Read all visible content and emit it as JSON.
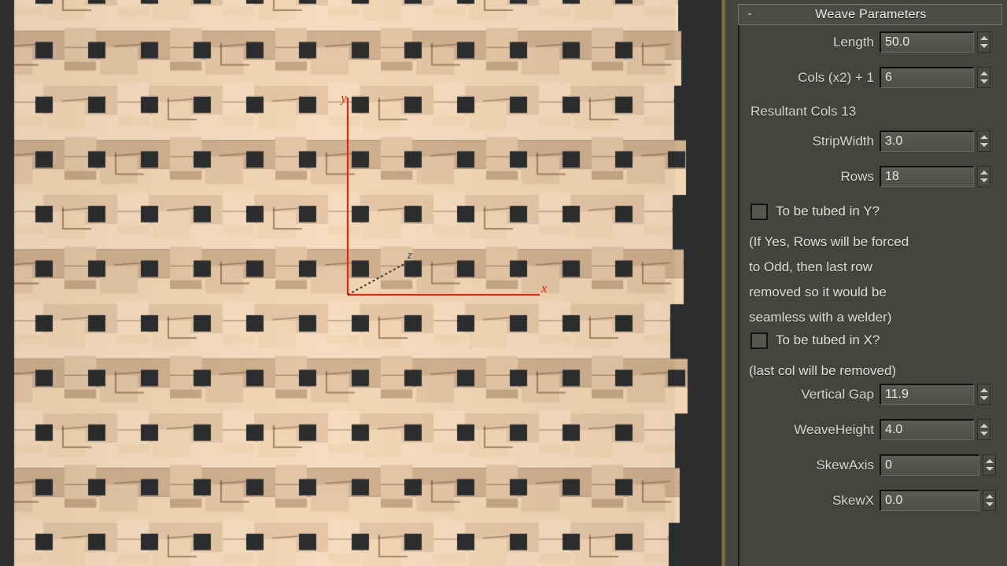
{
  "viewport": {
    "name": "perspective-viewport",
    "background_color": "#2b2d2f",
    "axis_gizmo": {
      "x_label": "x",
      "y_label": "y",
      "z_label": "z",
      "axis_color": "#ee2211"
    },
    "weave": {
      "light_color": "#f6dcbe",
      "mid_color": "#e4c6a6",
      "dark_color": "#cfb08f",
      "gap_color": "#2c2d2f"
    }
  },
  "panel": {
    "minimize_label": "-",
    "title": "Weave Parameters",
    "divider_color": "#7d7443",
    "background_color": "#454540",
    "rows": [
      {
        "kind": "spinner",
        "label": "Length",
        "value": "50.0",
        "field_width": 120,
        "name": "length"
      },
      {
        "kind": "spinner",
        "label": "Cols (x2) + 1",
        "value": "6",
        "field_width": 120,
        "name": "cols-x2-plus-1"
      },
      {
        "kind": "static",
        "label": "Resultant Cols 13",
        "name": "resultant-cols"
      },
      {
        "kind": "spinner",
        "label": "StripWidth",
        "value": "3.0",
        "field_width": 120,
        "name": "strip-width"
      },
      {
        "kind": "spinner",
        "label": "Rows",
        "value": "18",
        "field_width": 120,
        "name": "rows"
      },
      {
        "kind": "checkbox",
        "label": "To be tubed in Y?",
        "checked": false,
        "name": "to-be-tubed-in-y"
      },
      {
        "kind": "note",
        "label": "(If Yes, Rows will be forced",
        "name": "note-line-1"
      },
      {
        "kind": "note",
        "label": "to Odd, then last row",
        "name": "note-line-2"
      },
      {
        "kind": "note",
        "label": "removed so it would be",
        "name": "note-line-3"
      },
      {
        "kind": "note",
        "label": "seamless with a welder)",
        "name": "note-line-4"
      },
      {
        "kind": "checkbox",
        "label": "To be tubed in X?",
        "checked": false,
        "name": "to-be-tubed-in-x"
      },
      {
        "kind": "note",
        "label": "(last col will be removed)",
        "name": "note-line-5"
      },
      {
        "kind": "spinner",
        "label": "Vertical Gap",
        "value": "11.9",
        "field_width": 120,
        "name": "vertical-gap"
      },
      {
        "kind": "spinner",
        "label": "WeaveHeight",
        "value": "4.0",
        "field_width": 120,
        "name": "weave-height"
      },
      {
        "kind": "spinner",
        "label": "SkewAxis",
        "value": "0",
        "field_width": 127,
        "name": "skew-axis"
      },
      {
        "kind": "spinner",
        "label": "SkewX",
        "value": "0.0",
        "field_width": 127,
        "name": "skew-x"
      }
    ]
  }
}
